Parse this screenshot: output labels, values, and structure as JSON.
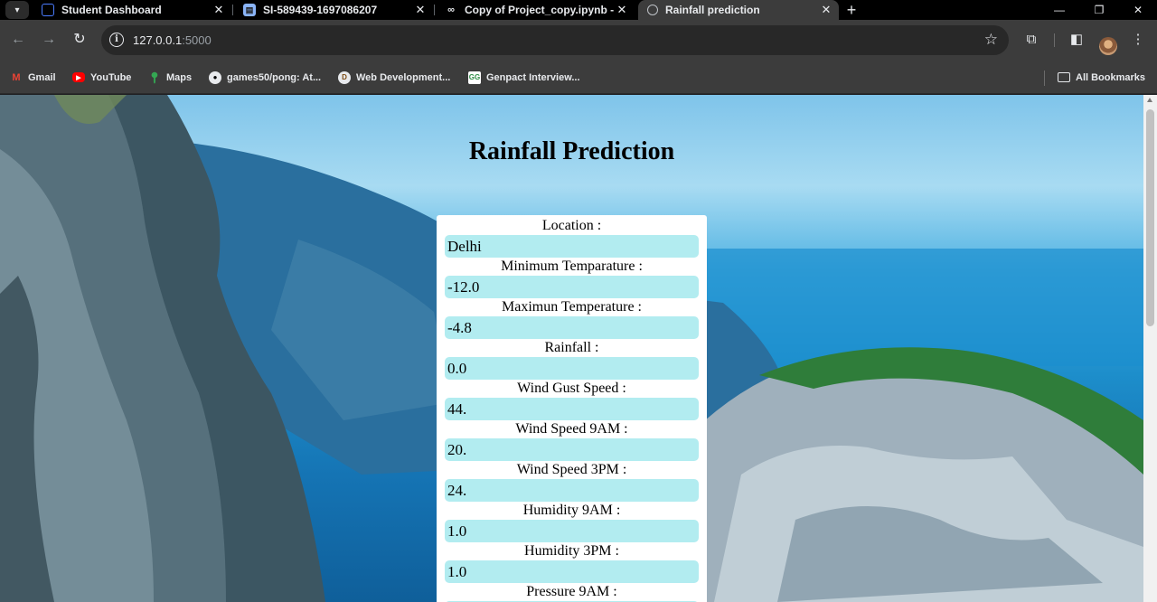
{
  "browser": {
    "tabs": [
      {
        "title": "Student Dashboard",
        "icon": "student-dashboard-icon"
      },
      {
        "title": "SI-589439-1697086207",
        "icon": "document-icon"
      },
      {
        "title": "Copy of Project_copy.ipynb - C",
        "icon": "colab-icon"
      },
      {
        "title": "Rainfall prediction",
        "icon": "globe-icon",
        "active": true
      }
    ],
    "address": {
      "host": "127.0.0.1",
      "port": ":5000"
    },
    "bookmarks": [
      {
        "label": "Gmail",
        "icon": "gmail-icon"
      },
      {
        "label": "YouTube",
        "icon": "youtube-icon"
      },
      {
        "label": "Maps",
        "icon": "maps-icon"
      },
      {
        "label": "games50/pong: At...",
        "icon": "github-icon"
      },
      {
        "label": "Web Development...",
        "icon": "web-dev-icon"
      },
      {
        "label": "Genpact Interview...",
        "icon": "geeksforgeeks-icon"
      }
    ],
    "all_bookmarks": "All Bookmarks"
  },
  "page": {
    "title": "Rainfall Prediction",
    "fields": [
      {
        "label": "Location :",
        "value": "Delhi"
      },
      {
        "label": "Minimum Temparature :",
        "value": "-12.0"
      },
      {
        "label": "Maximun Temperature :",
        "value": "-4.8"
      },
      {
        "label": "Rainfall :",
        "value": "0.0"
      },
      {
        "label": "Wind Gust Speed :",
        "value": "44."
      },
      {
        "label": "Wind Speed 9AM :",
        "value": "20."
      },
      {
        "label": "Wind Speed 3PM :",
        "value": "24."
      },
      {
        "label": "Humidity 9AM :",
        "value": "1.0"
      },
      {
        "label": "Humidity 3PM :",
        "value": "1.0"
      },
      {
        "label": "Pressure 9AM :",
        "value": ""
      }
    ]
  },
  "colors": {
    "input_bg": "#b2ecf0",
    "chrome_bg": "#3c3c3c",
    "tabstrip_bg": "#000000"
  }
}
